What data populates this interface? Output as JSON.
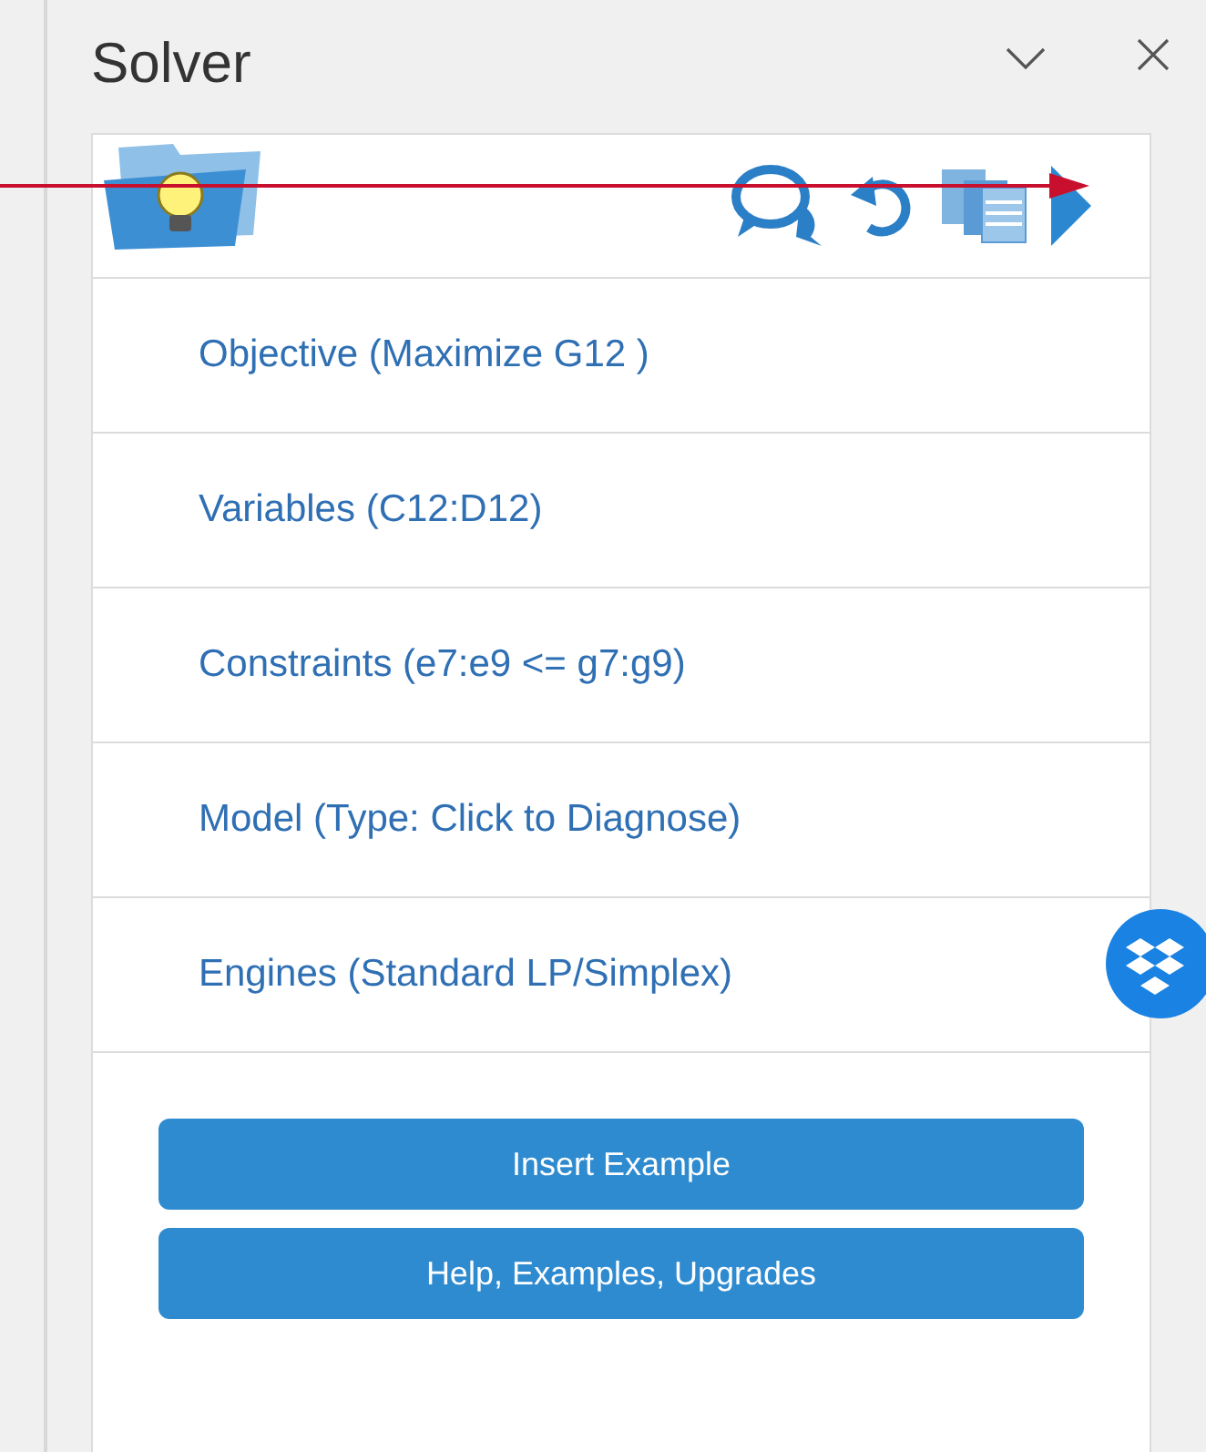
{
  "pane": {
    "title": "Solver"
  },
  "items": [
    {
      "label": "Objective (Maximize G12 )"
    },
    {
      "label": "Variables (C12:D12)"
    },
    {
      "label": "Constraints (e7:e9 <= g7:g9)"
    },
    {
      "label": "Model (Type: Click to Diagnose)"
    },
    {
      "label": "Engines (Standard LP/Simplex)"
    }
  ],
  "buttons": [
    {
      "label": "Insert Example"
    },
    {
      "label": "Help, Examples, Upgrades"
    }
  ]
}
